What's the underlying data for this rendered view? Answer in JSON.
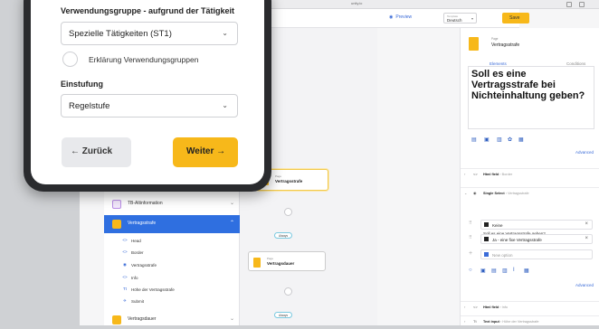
{
  "browser": {
    "url": "unity.io"
  },
  "appbar": {
    "preview_label": "Preview",
    "lang_label": "Template",
    "lang_value": "Deutsch",
    "save_label": "Save"
  },
  "flow": {
    "edge_label": "Always",
    "nodes": [
      {
        "sub": "",
        "title": "TB-Altinformation"
      },
      {
        "sub": "Page",
        "title": "Vertragsstrafe"
      },
      {
        "sub": "Page",
        "title": "Vertragsdauer"
      }
    ]
  },
  "sidebar": {
    "items": [
      {
        "label": "TB-Altinformation",
        "chev": "⌄"
      },
      {
        "label": "Vertragsstrafe",
        "chev": "⌃"
      },
      {
        "label": "Vertragsdauer",
        "chev": "⌄"
      }
    ],
    "subitems": [
      {
        "icon": "<>",
        "label": "Head"
      },
      {
        "icon": "<>",
        "label": "Border"
      },
      {
        "icon": "◉",
        "label": "Vertragsstrafe"
      },
      {
        "icon": "<>",
        "label": "Info"
      },
      {
        "icon": "Tt",
        "label": "Höhe der Vertragsstrafe"
      },
      {
        "icon": "✈",
        "label": "Submit"
      }
    ]
  },
  "panel": {
    "head_sub": "Page",
    "head_title": "Vertragsstrafe",
    "tabs": [
      "Elements",
      "Conditions"
    ],
    "preview_text": "Soll es eine Vertragsstrafe bei Nichteinhaltung geben?",
    "advanced": "Advanced",
    "sections": [
      {
        "label": "Html field",
        "meta": " › Border"
      },
      {
        "label": "Single Select",
        "meta": " › Vertragsstrafe"
      },
      {
        "label": "Html field",
        "meta": " › Info"
      },
      {
        "label": "Text input",
        "meta": " › Höhe der Vertragsstrafe"
      }
    ],
    "caption_label": "Caption de",
    "caption_value": "Soll es eine Vertragsstrafe geben?",
    "options": [
      "Keine",
      "Ja - eine fixe Vertragsstrafe"
    ],
    "new_option": "New option"
  },
  "phone": {
    "group_heading": "Verwendungsgruppe - aufgrund der Tätigkeit",
    "group_value": "Spezielle Tätigkeiten (ST1)",
    "explain_label": "Erklärung Verwendungsgruppen",
    "einstufung_heading": "Einstufung",
    "einstufung_value": "Regelstufe",
    "back_label": "← Zurück",
    "next_label": "Weiter →"
  }
}
